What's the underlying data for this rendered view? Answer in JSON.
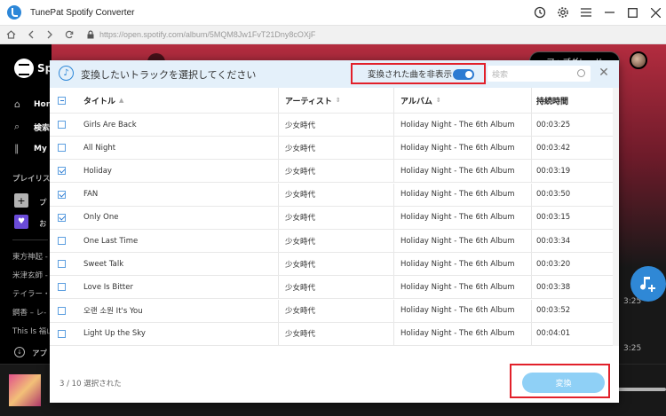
{
  "app": {
    "title": "TunePat Spotify Converter"
  },
  "url": "https://open.spotify.com/album/5MQM8Jw1FvT21Dny8cOXjF",
  "spotify": {
    "brand": "Sp",
    "nav": [
      {
        "icon": "home-icon",
        "label": "Hon"
      },
      {
        "icon": "search-icon",
        "label": "検索"
      },
      {
        "icon": "library-icon",
        "label": "My"
      }
    ],
    "playlists_heading": "プレイリス",
    "create_label": "プ",
    "liked_label": "お",
    "playlists": [
      "東方神起 -",
      "米津玄師 -",
      "テイラー・",
      "鋼香 – レ-",
      "This Is 福山"
    ],
    "install_label": "アプ",
    "upgrade_label": "アップグレード",
    "times": [
      "3:25",
      "3:25"
    ]
  },
  "dialog": {
    "title": "変換したいトラックを選択してください",
    "hide_converted_label": "変換された曲を非表示",
    "hide_converted_on": true,
    "search_placeholder": "検索",
    "columns": {
      "title": "タイトル",
      "artist": "アーティスト",
      "album": "アルバム",
      "duration": "持続時間"
    },
    "header_checkbox": "indeterminate",
    "tracks": [
      {
        "checked": false,
        "title": "Girls Are Back",
        "artist": "少女時代",
        "album": "Holiday Night - The 6th Album",
        "duration": "00:03:25"
      },
      {
        "checked": false,
        "title": "All Night",
        "artist": "少女時代",
        "album": "Holiday Night - The 6th Album",
        "duration": "00:03:42"
      },
      {
        "checked": true,
        "title": "Holiday",
        "artist": "少女時代",
        "album": "Holiday Night - The 6th Album",
        "duration": "00:03:19"
      },
      {
        "checked": true,
        "title": "FAN",
        "artist": "少女時代",
        "album": "Holiday Night - The 6th Album",
        "duration": "00:03:50"
      },
      {
        "checked": true,
        "title": "Only One",
        "artist": "少女時代",
        "album": "Holiday Night - The 6th Album",
        "duration": "00:03:15"
      },
      {
        "checked": false,
        "title": "One Last Time",
        "artist": "少女時代",
        "album": "Holiday Night - The 6th Album",
        "duration": "00:03:34"
      },
      {
        "checked": false,
        "title": "Sweet Talk",
        "artist": "少女時代",
        "album": "Holiday Night - The 6th Album",
        "duration": "00:03:20"
      },
      {
        "checked": false,
        "title": "Love Is Bitter",
        "artist": "少女時代",
        "album": "Holiday Night - The 6th Album",
        "duration": "00:03:38"
      },
      {
        "checked": false,
        "title": "오랜 소원 It's You",
        "artist": "少女時代",
        "album": "Holiday Night - The 6th Album",
        "duration": "00:03:52"
      },
      {
        "checked": false,
        "title": "Light Up the Sky",
        "artist": "少女時代",
        "album": "Holiday Night - The 6th Album",
        "duration": "00:04:01"
      }
    ],
    "selected_count": "3 / 10 選択された",
    "convert_label": "変換"
  },
  "colors": {
    "accent": "#2d87d8",
    "highlight": "#e2202a",
    "convert": "#8fd0f6"
  }
}
